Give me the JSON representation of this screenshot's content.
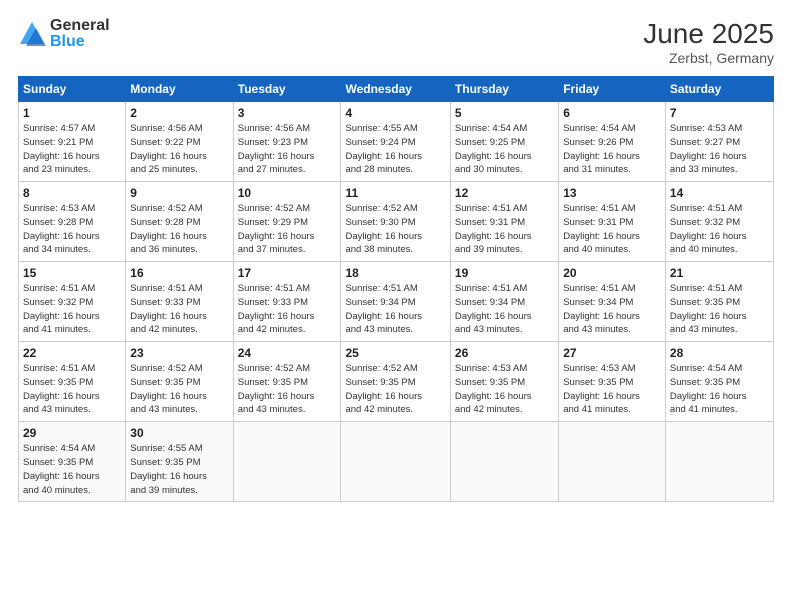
{
  "header": {
    "logo_general": "General",
    "logo_blue": "Blue",
    "month_year": "June 2025",
    "location": "Zerbst, Germany"
  },
  "weekdays": [
    "Sunday",
    "Monday",
    "Tuesday",
    "Wednesday",
    "Thursday",
    "Friday",
    "Saturday"
  ],
  "weeks": [
    [
      {
        "day": "1",
        "info": "Sunrise: 4:57 AM\nSunset: 9:21 PM\nDaylight: 16 hours\nand 23 minutes."
      },
      {
        "day": "2",
        "info": "Sunrise: 4:56 AM\nSunset: 9:22 PM\nDaylight: 16 hours\nand 25 minutes."
      },
      {
        "day": "3",
        "info": "Sunrise: 4:56 AM\nSunset: 9:23 PM\nDaylight: 16 hours\nand 27 minutes."
      },
      {
        "day": "4",
        "info": "Sunrise: 4:55 AM\nSunset: 9:24 PM\nDaylight: 16 hours\nand 28 minutes."
      },
      {
        "day": "5",
        "info": "Sunrise: 4:54 AM\nSunset: 9:25 PM\nDaylight: 16 hours\nand 30 minutes."
      },
      {
        "day": "6",
        "info": "Sunrise: 4:54 AM\nSunset: 9:26 PM\nDaylight: 16 hours\nand 31 minutes."
      },
      {
        "day": "7",
        "info": "Sunrise: 4:53 AM\nSunset: 9:27 PM\nDaylight: 16 hours\nand 33 minutes."
      }
    ],
    [
      {
        "day": "8",
        "info": "Sunrise: 4:53 AM\nSunset: 9:28 PM\nDaylight: 16 hours\nand 34 minutes."
      },
      {
        "day": "9",
        "info": "Sunrise: 4:52 AM\nSunset: 9:28 PM\nDaylight: 16 hours\nand 36 minutes."
      },
      {
        "day": "10",
        "info": "Sunrise: 4:52 AM\nSunset: 9:29 PM\nDaylight: 16 hours\nand 37 minutes."
      },
      {
        "day": "11",
        "info": "Sunrise: 4:52 AM\nSunset: 9:30 PM\nDaylight: 16 hours\nand 38 minutes."
      },
      {
        "day": "12",
        "info": "Sunrise: 4:51 AM\nSunset: 9:31 PM\nDaylight: 16 hours\nand 39 minutes."
      },
      {
        "day": "13",
        "info": "Sunrise: 4:51 AM\nSunset: 9:31 PM\nDaylight: 16 hours\nand 40 minutes."
      },
      {
        "day": "14",
        "info": "Sunrise: 4:51 AM\nSunset: 9:32 PM\nDaylight: 16 hours\nand 40 minutes."
      }
    ],
    [
      {
        "day": "15",
        "info": "Sunrise: 4:51 AM\nSunset: 9:32 PM\nDaylight: 16 hours\nand 41 minutes."
      },
      {
        "day": "16",
        "info": "Sunrise: 4:51 AM\nSunset: 9:33 PM\nDaylight: 16 hours\nand 42 minutes."
      },
      {
        "day": "17",
        "info": "Sunrise: 4:51 AM\nSunset: 9:33 PM\nDaylight: 16 hours\nand 42 minutes."
      },
      {
        "day": "18",
        "info": "Sunrise: 4:51 AM\nSunset: 9:34 PM\nDaylight: 16 hours\nand 43 minutes."
      },
      {
        "day": "19",
        "info": "Sunrise: 4:51 AM\nSunset: 9:34 PM\nDaylight: 16 hours\nand 43 minutes."
      },
      {
        "day": "20",
        "info": "Sunrise: 4:51 AM\nSunset: 9:34 PM\nDaylight: 16 hours\nand 43 minutes."
      },
      {
        "day": "21",
        "info": "Sunrise: 4:51 AM\nSunset: 9:35 PM\nDaylight: 16 hours\nand 43 minutes."
      }
    ],
    [
      {
        "day": "22",
        "info": "Sunrise: 4:51 AM\nSunset: 9:35 PM\nDaylight: 16 hours\nand 43 minutes."
      },
      {
        "day": "23",
        "info": "Sunrise: 4:52 AM\nSunset: 9:35 PM\nDaylight: 16 hours\nand 43 minutes."
      },
      {
        "day": "24",
        "info": "Sunrise: 4:52 AM\nSunset: 9:35 PM\nDaylight: 16 hours\nand 43 minutes."
      },
      {
        "day": "25",
        "info": "Sunrise: 4:52 AM\nSunset: 9:35 PM\nDaylight: 16 hours\nand 42 minutes."
      },
      {
        "day": "26",
        "info": "Sunrise: 4:53 AM\nSunset: 9:35 PM\nDaylight: 16 hours\nand 42 minutes."
      },
      {
        "day": "27",
        "info": "Sunrise: 4:53 AM\nSunset: 9:35 PM\nDaylight: 16 hours\nand 41 minutes."
      },
      {
        "day": "28",
        "info": "Sunrise: 4:54 AM\nSunset: 9:35 PM\nDaylight: 16 hours\nand 41 minutes."
      }
    ],
    [
      {
        "day": "29",
        "info": "Sunrise: 4:54 AM\nSunset: 9:35 PM\nDaylight: 16 hours\nand 40 minutes."
      },
      {
        "day": "30",
        "info": "Sunrise: 4:55 AM\nSunset: 9:35 PM\nDaylight: 16 hours\nand 39 minutes."
      },
      {
        "day": "",
        "info": ""
      },
      {
        "day": "",
        "info": ""
      },
      {
        "day": "",
        "info": ""
      },
      {
        "day": "",
        "info": ""
      },
      {
        "day": "",
        "info": ""
      }
    ]
  ]
}
